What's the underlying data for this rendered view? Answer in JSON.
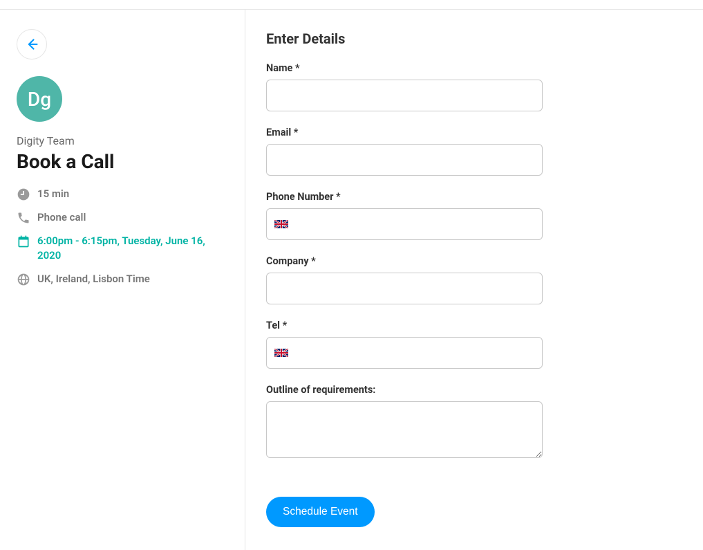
{
  "avatar_text": "Dg",
  "sidebar": {
    "team_name": "Digity Team",
    "event_title": "Book a Call",
    "duration": "15 min",
    "method": "Phone call",
    "slot": "6:00pm - 6:15pm, Tuesday, June 16, 2020",
    "timezone": "UK, Ireland, Lisbon Time"
  },
  "form": {
    "title": "Enter Details",
    "fields": {
      "name": {
        "label": "Name *",
        "value": ""
      },
      "email": {
        "label": "Email *",
        "value": ""
      },
      "phone": {
        "label": "Phone Number *",
        "value": "",
        "flag": "gb"
      },
      "company": {
        "label": "Company *",
        "value": ""
      },
      "tel": {
        "label": "Tel *",
        "value": "",
        "flag": "gb"
      },
      "outline": {
        "label": "Outline of requirements:",
        "value": ""
      }
    },
    "submit_label": "Schedule Event"
  }
}
